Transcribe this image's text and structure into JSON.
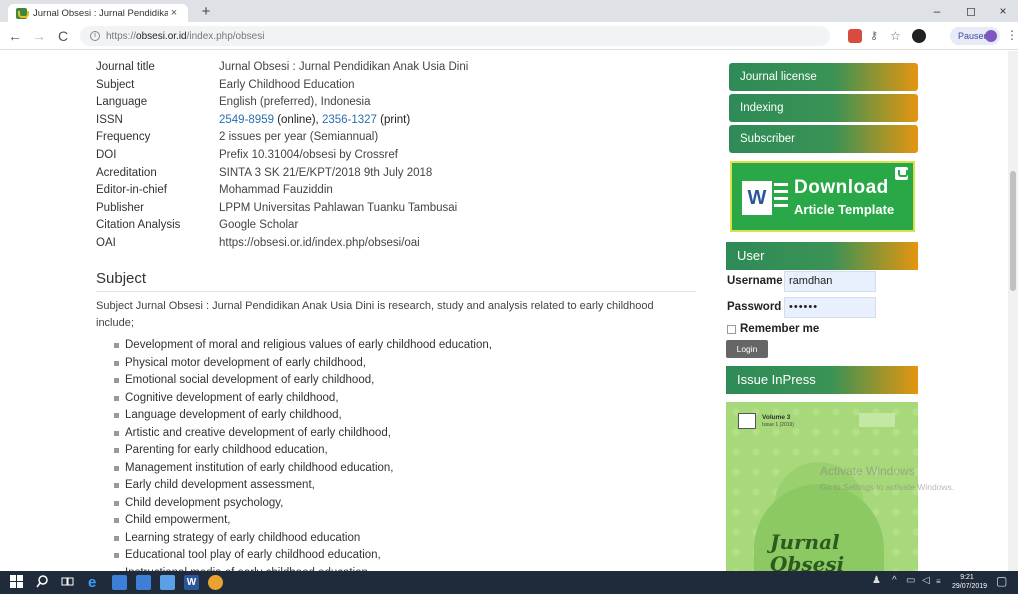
{
  "browser": {
    "tab_title": "Jurnal Obsesi : Jurnal Pendidikan",
    "tab_close": "×",
    "new_tab": "+",
    "window_controls": {
      "minimize": "–",
      "maximize": "◻",
      "close": "×"
    },
    "nav": {
      "back": "←",
      "forward": "→",
      "reload": "C"
    },
    "url_scheme": "https://",
    "url_host": "obsesi.or.id",
    "url_path": "/index.php/obsesi",
    "profile_status": "Paused"
  },
  "info_table": [
    {
      "key": "Journal title",
      "value": "Jurnal Obsesi : Jurnal Pendidikan Anak Usia Dini"
    },
    {
      "key": "Subject",
      "value": "Early Childhood Education"
    },
    {
      "key": "Language",
      "value": "English (preferred), Indonesia"
    },
    {
      "key": "ISSN",
      "value_online": "2549-8959",
      "online_label": " (online), ",
      "value_print": "2356-1327",
      "print_label": " (print)"
    },
    {
      "key": "Frequency",
      "value": "2 issues per year (Semiannual)"
    },
    {
      "key": "DOI",
      "value": "Prefix 10.31004/obsesi by Crossref"
    },
    {
      "key": "Acreditation",
      "value": "SINTA 3 SK 21/E/KPT/2018  9th July 2018"
    },
    {
      "key": "Editor-in-chief",
      "value": "Mohammad Fauziddin"
    },
    {
      "key": "Publisher",
      "value": "LPPM Universitas Pahlawan Tuanku Tambusai"
    },
    {
      "key": "Citation Analysis",
      "value": "Google Scholar"
    },
    {
      "key": "OAI",
      "value": "https://obsesi.or.id/index.php/obsesi/oai"
    }
  ],
  "subject": {
    "title": "Subject",
    "intro": "Subject Jurnal Obsesi : Jurnal Pendidikan Anak Usia Dini is research, study and analysis related to early childhood include;",
    "items": [
      "Development of moral and religious values of early childhood education,",
      "Physical motor development of early childhood,",
      "Emotional social development of early childhood,",
      "Cognitive development of early childhood,",
      "Language development of early childhood,",
      "Artistic and creative development of early childhood,",
      "Parenting for early childhood education,",
      "Management institution of early childhood education,",
      "Early child development assessment,",
      "Child development psychology,",
      "Child empowerment,",
      "Learning strategy of early childhood education",
      "Educational tool play of early childhood education,",
      "Instructional media of early childhood education,"
    ]
  },
  "sidebar": {
    "menu": [
      "Journal license",
      "Indexing",
      "Subscriber"
    ],
    "download": {
      "line1": "Download",
      "line2": "Article Template",
      "word_letter": "W"
    },
    "user": {
      "heading": "User",
      "username_label": "Username",
      "username_value": "ramdhan",
      "password_label": "Password",
      "password_value": "••••••",
      "remember_label": "Remember me",
      "login_label": "Login"
    },
    "issue": {
      "heading": "Issue InPress",
      "cover_volume": "Volume 3",
      "cover_issue": "Issue 1 (2019)",
      "cover_script": "Jurnal Obsesi"
    }
  },
  "watermark": {
    "line1": "Activate Windows",
    "line2": "Go to Settings to activate Windows."
  },
  "taskbar": {
    "time": "9:21",
    "date": "29/07/2019"
  },
  "colors": {
    "gradient_green": "#2e8b57",
    "gradient_orange": "#e59510",
    "link_blue": "#2a6fb0",
    "taskbar": "#1f2a3a"
  }
}
